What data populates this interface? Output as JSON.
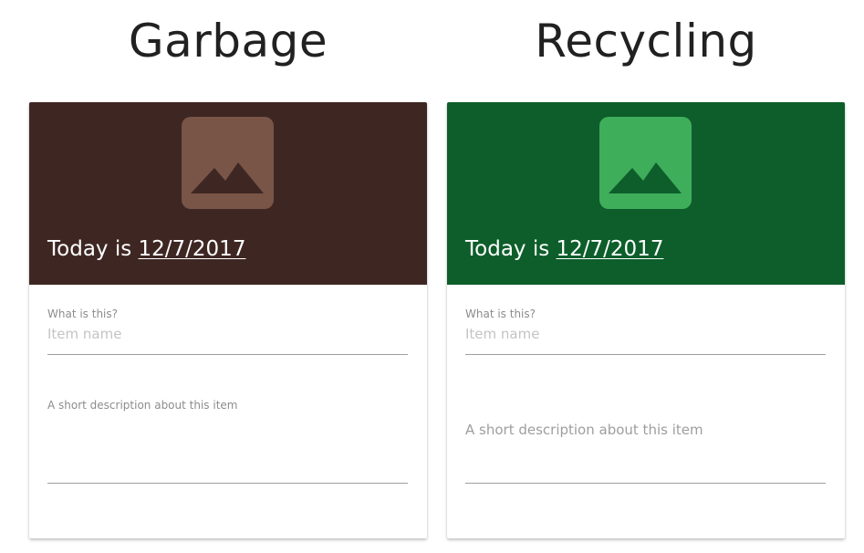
{
  "columns": {
    "garbage": {
      "title": "Garbage",
      "header_color": "#3e2723",
      "image_tile_color": "#795548",
      "image_mountain_color": "#3e2723",
      "date_prefix": "Today is",
      "date_value": "12/7/2017",
      "item_label": "What is this?",
      "item_placeholder": "Item name",
      "description_label": "A short description about this item",
      "image_icon": "image-placeholder-icon"
    },
    "recycling": {
      "title": "Recycling",
      "header_color": "#0d5e2a",
      "image_tile_color": "#3fae5b",
      "image_mountain_color": "#0d5e2a",
      "date_prefix": "Today is",
      "date_value": "12/7/2017",
      "item_label": "What is this?",
      "item_placeholder": "Item name",
      "description_label": "A short description about this item",
      "image_icon": "image-placeholder-icon"
    }
  }
}
